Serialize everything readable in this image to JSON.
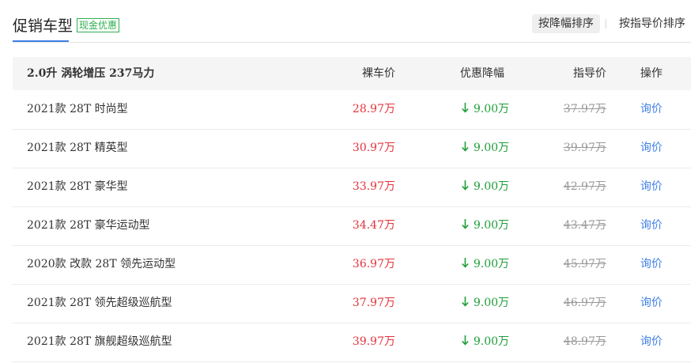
{
  "header": {
    "title": "促销车型",
    "badge": "现金优惠",
    "sort_by_discount": "按降幅排序",
    "sort_by_guide_price": "按指导价排序"
  },
  "table": {
    "engine_group": "2.0升 涡轮增压 237马力",
    "columns": {
      "naked_price": "裸车价",
      "discount": "优惠降幅",
      "guide_price": "指导价",
      "action": "操作"
    },
    "rows": [
      {
        "name": "2021款 28T 时尚型",
        "naked_price": "28.97万",
        "discount": "9.00万",
        "guide_price": "37.97万",
        "action": "询价"
      },
      {
        "name": "2021款 28T 精英型",
        "naked_price": "30.97万",
        "discount": "9.00万",
        "guide_price": "39.97万",
        "action": "询价"
      },
      {
        "name": "2021款 28T 豪华型",
        "naked_price": "33.97万",
        "discount": "9.00万",
        "guide_price": "42.97万",
        "action": "询价"
      },
      {
        "name": "2021款 28T 豪华运动型",
        "naked_price": "34.47万",
        "discount": "9.00万",
        "guide_price": "43.47万",
        "action": "询价"
      },
      {
        "name": "2020款 改款 28T 领先运动型",
        "naked_price": "36.97万",
        "discount": "9.00万",
        "guide_price": "45.97万",
        "action": "询价"
      },
      {
        "name": "2021款 28T 领先超级巡航型",
        "naked_price": "37.97万",
        "discount": "9.00万",
        "guide_price": "46.97万",
        "action": "询价"
      },
      {
        "name": "2021款 28T 旗舰超级巡航型",
        "naked_price": "39.97万",
        "discount": "9.00万",
        "guide_price": "48.97万",
        "action": "询价"
      }
    ]
  },
  "icons": {
    "discount_arrow": "arrow-down-icon"
  },
  "colors": {
    "accent": "#3f7fe6",
    "price_red": "#e5323c",
    "discount_green": "#1e9e39",
    "badge_green": "#2fae4f",
    "muted": "#999999"
  }
}
